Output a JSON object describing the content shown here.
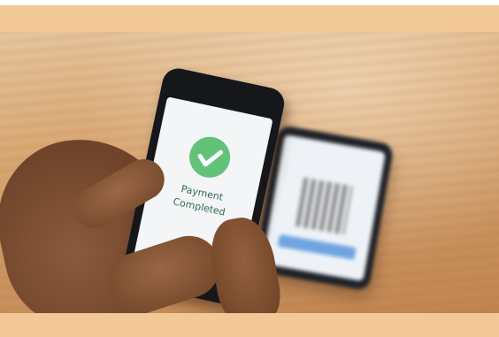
{
  "phone_screen": {
    "status_icon": "checkmark-icon",
    "message_line1": "Payment",
    "message_line2": "Completed"
  },
  "colors": {
    "banner": "#f2c896",
    "check_green": "#62c27a",
    "qr_button_blue": "#6fa4e0"
  }
}
